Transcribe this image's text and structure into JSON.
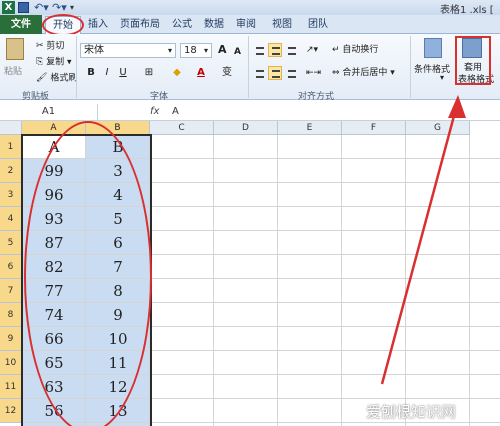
{
  "window": {
    "title": "表格1 .xls ["
  },
  "tabs": [
    "文件",
    "开始",
    "插入",
    "页面布局",
    "公式",
    "数据",
    "审阅",
    "视图",
    "团队"
  ],
  "ribbon": {
    "paste_label": "粘贴",
    "cut_label": "剪切",
    "copy_label": "复制",
    "format_painter_label": "格式刷",
    "font_name": "宋体",
    "font_size": "18",
    "grow_font": "A",
    "shrink_font": "A",
    "bold": "B",
    "italic": "I",
    "underline": "U",
    "font_color": "A",
    "wrap_text_label": "自动换行",
    "merge_center_label": "合并后居中",
    "conditional_format_label": "条件格式",
    "table_format_label_line1": "套用",
    "table_format_label_line2": "表格格式",
    "groups": {
      "clipboard": "剪贴板",
      "font": "字体",
      "alignment": "对齐方式"
    }
  },
  "formula_bar": {
    "name_box": "A1",
    "fx": "fx",
    "content": "A"
  },
  "grid": {
    "columns": [
      "A",
      "B",
      "C",
      "D",
      "E",
      "F",
      "G"
    ],
    "rows": [
      "1",
      "2",
      "3",
      "4",
      "5",
      "6",
      "7",
      "8",
      "9",
      "10",
      "11",
      "12"
    ],
    "col_a": [
      "A",
      "99",
      "96",
      "93",
      "87",
      "82",
      "77",
      "74",
      "66",
      "65",
      "63",
      "56"
    ],
    "col_b": [
      "B",
      "3",
      "4",
      "5",
      "6",
      "7",
      "8",
      "9",
      "10",
      "11",
      "12",
      "13"
    ]
  },
  "watermark": "爱刨根知识网",
  "colors": {
    "annotation_red": "#d8302f",
    "selection": "#c9dcf2",
    "file_tab": "#2a6f3a"
  }
}
